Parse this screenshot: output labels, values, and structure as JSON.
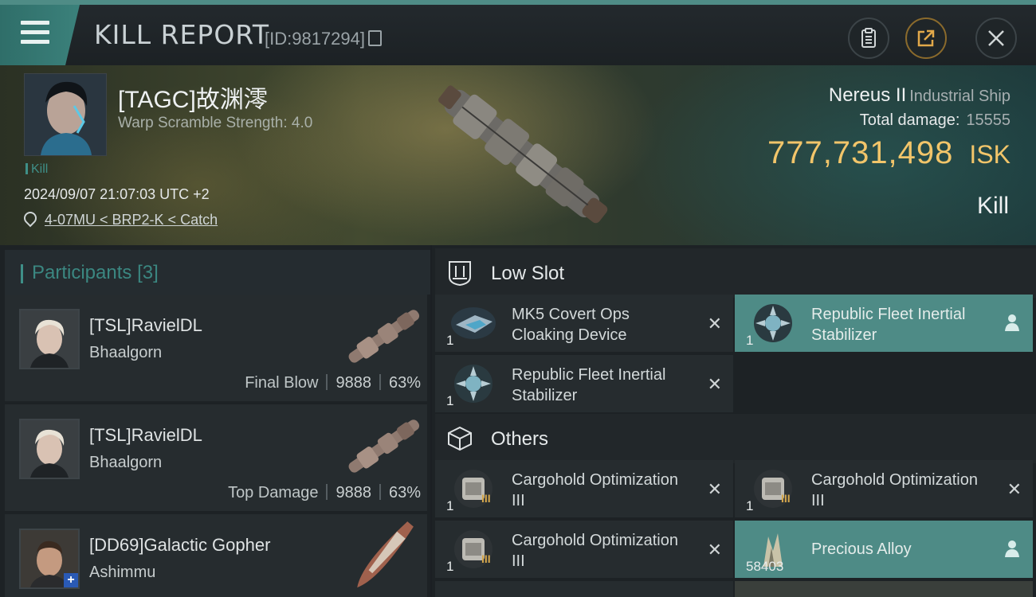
{
  "header": {
    "title": "KILL REPORT",
    "report_id": "[ID:9817294]"
  },
  "victim": {
    "name": "[TAGC]故渊澪",
    "warp_scramble": "Warp Scramble Strength: 4.0",
    "tag": "Kill",
    "datetime": "2024/09/07 21:07:03 UTC +2",
    "location": "4-07MU < BRP2-K < Catch",
    "ship": "Nereus II",
    "ship_class": "Industrial Ship",
    "total_damage_label": "Total damage:",
    "total_damage": "15555",
    "isk_value": "777,731,498",
    "isk_unit": "ISK",
    "result": "Kill"
  },
  "participants": {
    "label": "Participants",
    "count": "[3]",
    "items": [
      {
        "name": "[TSL]RavielDL",
        "ship": "Bhaalgorn",
        "role": "Final Blow",
        "damage": "9888",
        "percent": "63%"
      },
      {
        "name": "[TSL]RavielDL",
        "ship": "Bhaalgorn",
        "role": "Top Damage",
        "damage": "9888",
        "percent": "63%"
      },
      {
        "name": "[DD69]Galactic Gopher",
        "ship": "Ashimmu",
        "role": "",
        "damage": "",
        "percent": ""
      }
    ]
  },
  "low_slot": {
    "label": "Low Slot",
    "items": [
      {
        "name": "MK5 Covert Ops Cloaking Device",
        "qty": "1",
        "status": "destroyed"
      },
      {
        "name": "Republic Fleet Inertial Stabilizer",
        "qty": "1",
        "status": "dropped"
      },
      {
        "name": "Republic Fleet Inertial Stabilizer",
        "qty": "1",
        "status": "destroyed"
      }
    ]
  },
  "others": {
    "label": "Others",
    "items": [
      {
        "name": "Cargohold Optimization III",
        "qty": "1",
        "level": "III",
        "status": "destroyed"
      },
      {
        "name": "Cargohold Optimization III",
        "qty": "1",
        "level": "III",
        "status": "destroyed"
      },
      {
        "name": "Cargohold Optimization III",
        "qty": "1",
        "level": "III",
        "status": "destroyed"
      },
      {
        "name": "Precious Alloy",
        "qty": "58403",
        "status": "dropped"
      }
    ]
  },
  "colors": {
    "accent": "#4e8b86",
    "isk": "#f2c56a",
    "background": "#1d2225"
  },
  "icons": [
    "menu-icon",
    "clipboard-icon",
    "share-icon",
    "close-icon",
    "map-pin-icon",
    "low-slot-icon",
    "others-box-icon",
    "person-icon"
  ]
}
